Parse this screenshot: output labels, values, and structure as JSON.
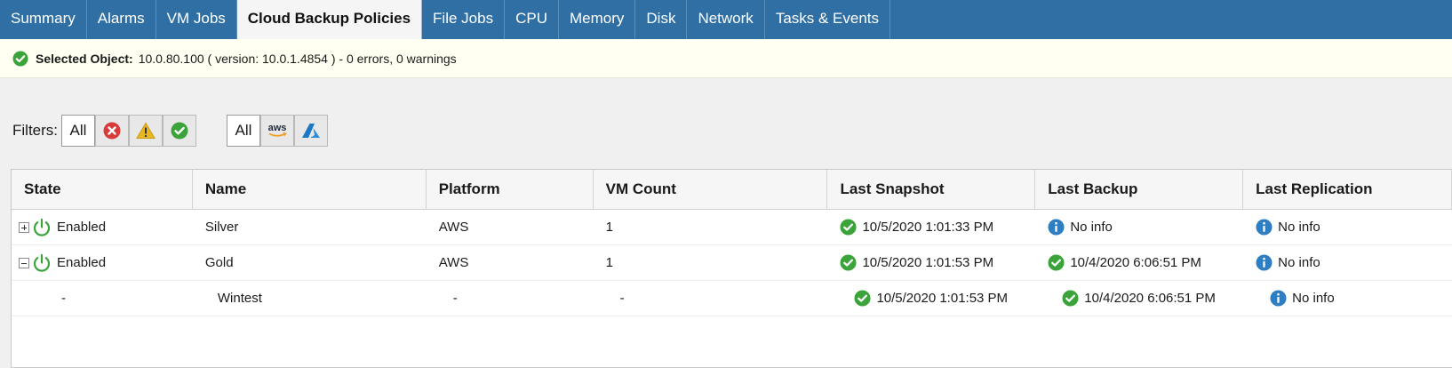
{
  "tabs": [
    {
      "label": "Summary",
      "active": false
    },
    {
      "label": "Alarms",
      "active": false
    },
    {
      "label": "VM Jobs",
      "active": false
    },
    {
      "label": "Cloud Backup Policies",
      "active": true
    },
    {
      "label": "File Jobs",
      "active": false
    },
    {
      "label": "CPU",
      "active": false
    },
    {
      "label": "Memory",
      "active": false
    },
    {
      "label": "Disk",
      "active": false
    },
    {
      "label": "Network",
      "active": false
    },
    {
      "label": "Tasks & Events",
      "active": false
    }
  ],
  "banner": {
    "icon": "check-circle-icon",
    "label": "Selected Object:",
    "text": "10.0.80.100 ( version: 10.0.1.4854 ) - 0 errors, 0 warnings"
  },
  "filters": {
    "label": "Filters:",
    "status_all": "All",
    "status_icons": [
      "error-icon",
      "warning-icon",
      "ok-icon"
    ],
    "platform_all": "All",
    "platform_icons": [
      "aws-icon",
      "azure-icon"
    ],
    "platform_aws_text": "aws"
  },
  "grid": {
    "columns": [
      "State",
      "Name",
      "Platform",
      "VM Count",
      "Last Snapshot",
      "Last Backup",
      "Last Replication"
    ],
    "rows": [
      {
        "expander": "plus",
        "state": "Enabled",
        "name": "Silver",
        "platform": "AWS",
        "vm_count": "1",
        "snapshot": "10/5/2020 1:01:33 PM",
        "snapshot_icon": "ok",
        "backup": "No info",
        "backup_icon": "info",
        "replication": "No info",
        "replication_icon": "info"
      },
      {
        "expander": "minus",
        "state": "Enabled",
        "name": "Gold",
        "platform": "AWS",
        "vm_count": "1",
        "snapshot": "10/5/2020 1:01:53 PM",
        "snapshot_icon": "ok",
        "backup": "10/4/2020 6:06:51 PM",
        "backup_icon": "ok",
        "replication": "No info",
        "replication_icon": "info"
      },
      {
        "expander": "none",
        "state": "-",
        "name": "Wintest",
        "platform": "-",
        "vm_count": "-",
        "snapshot": "10/5/2020 1:01:53 PM",
        "snapshot_icon": "ok",
        "backup": "10/4/2020 6:06:51 PM",
        "backup_icon": "ok",
        "replication": "No info",
        "replication_icon": "info"
      }
    ]
  },
  "colors": {
    "tab_bar": "#2f6fa3",
    "ok": "#3aa33a",
    "error": "#d93b3b",
    "warning": "#e9b820",
    "info": "#2f7ec2",
    "power": "#3aa33a",
    "aws": "#f29b1d",
    "azure": "#1a78c6"
  }
}
